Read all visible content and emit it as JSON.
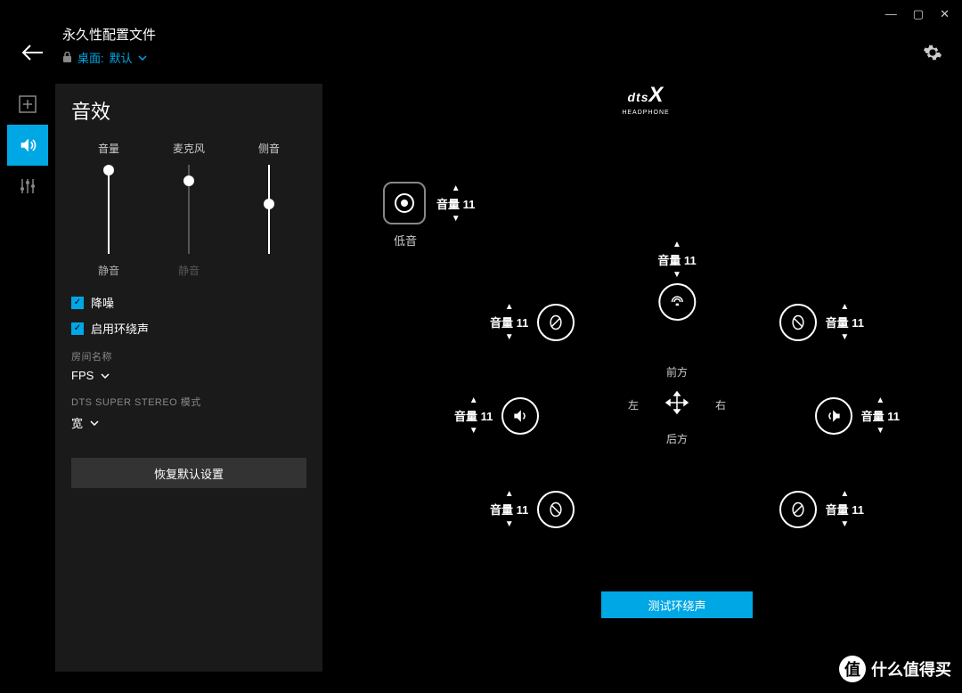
{
  "window": {
    "minimize": "—",
    "maximize": "▢",
    "close": "✕"
  },
  "header": {
    "title": "永久性配置文件",
    "desktop_label": "桌面:",
    "profile": "默认"
  },
  "panel": {
    "title": "音效",
    "sliders": {
      "volume": {
        "label": "音量",
        "mute": "静音",
        "pos": 0
      },
      "mic": {
        "label": "麦克风",
        "mute": "静音",
        "pos": 12
      },
      "sidetone": {
        "label": "侧音",
        "mute": "",
        "pos": 38
      }
    },
    "checks": {
      "noise_reduction": "降噪",
      "surround_enable": "启用环绕声"
    },
    "room": {
      "label": "房间名称",
      "value": "FPS"
    },
    "stereo": {
      "label": "DTS SUPER STEREO 模式",
      "value": "宽"
    },
    "reset": "恢复默认设置"
  },
  "bass": {
    "volume_label": "音量 11",
    "label": "低音"
  },
  "speakers": {
    "center": "音量 11",
    "front_left": "音量 11",
    "front_right": "音量 11",
    "side_left": "音量 11",
    "side_right": "音量 11",
    "rear_left": "音量 11",
    "rear_right": "音量 11"
  },
  "directions": {
    "front": "前方",
    "rear": "后方",
    "left": "左",
    "right": "右"
  },
  "test_button": "测试环绕声",
  "dts": {
    "brand": "dts",
    "line": "HEADPHONE",
    "x": "X"
  },
  "watermark": {
    "icon": "值",
    "text": "什么值得买"
  }
}
